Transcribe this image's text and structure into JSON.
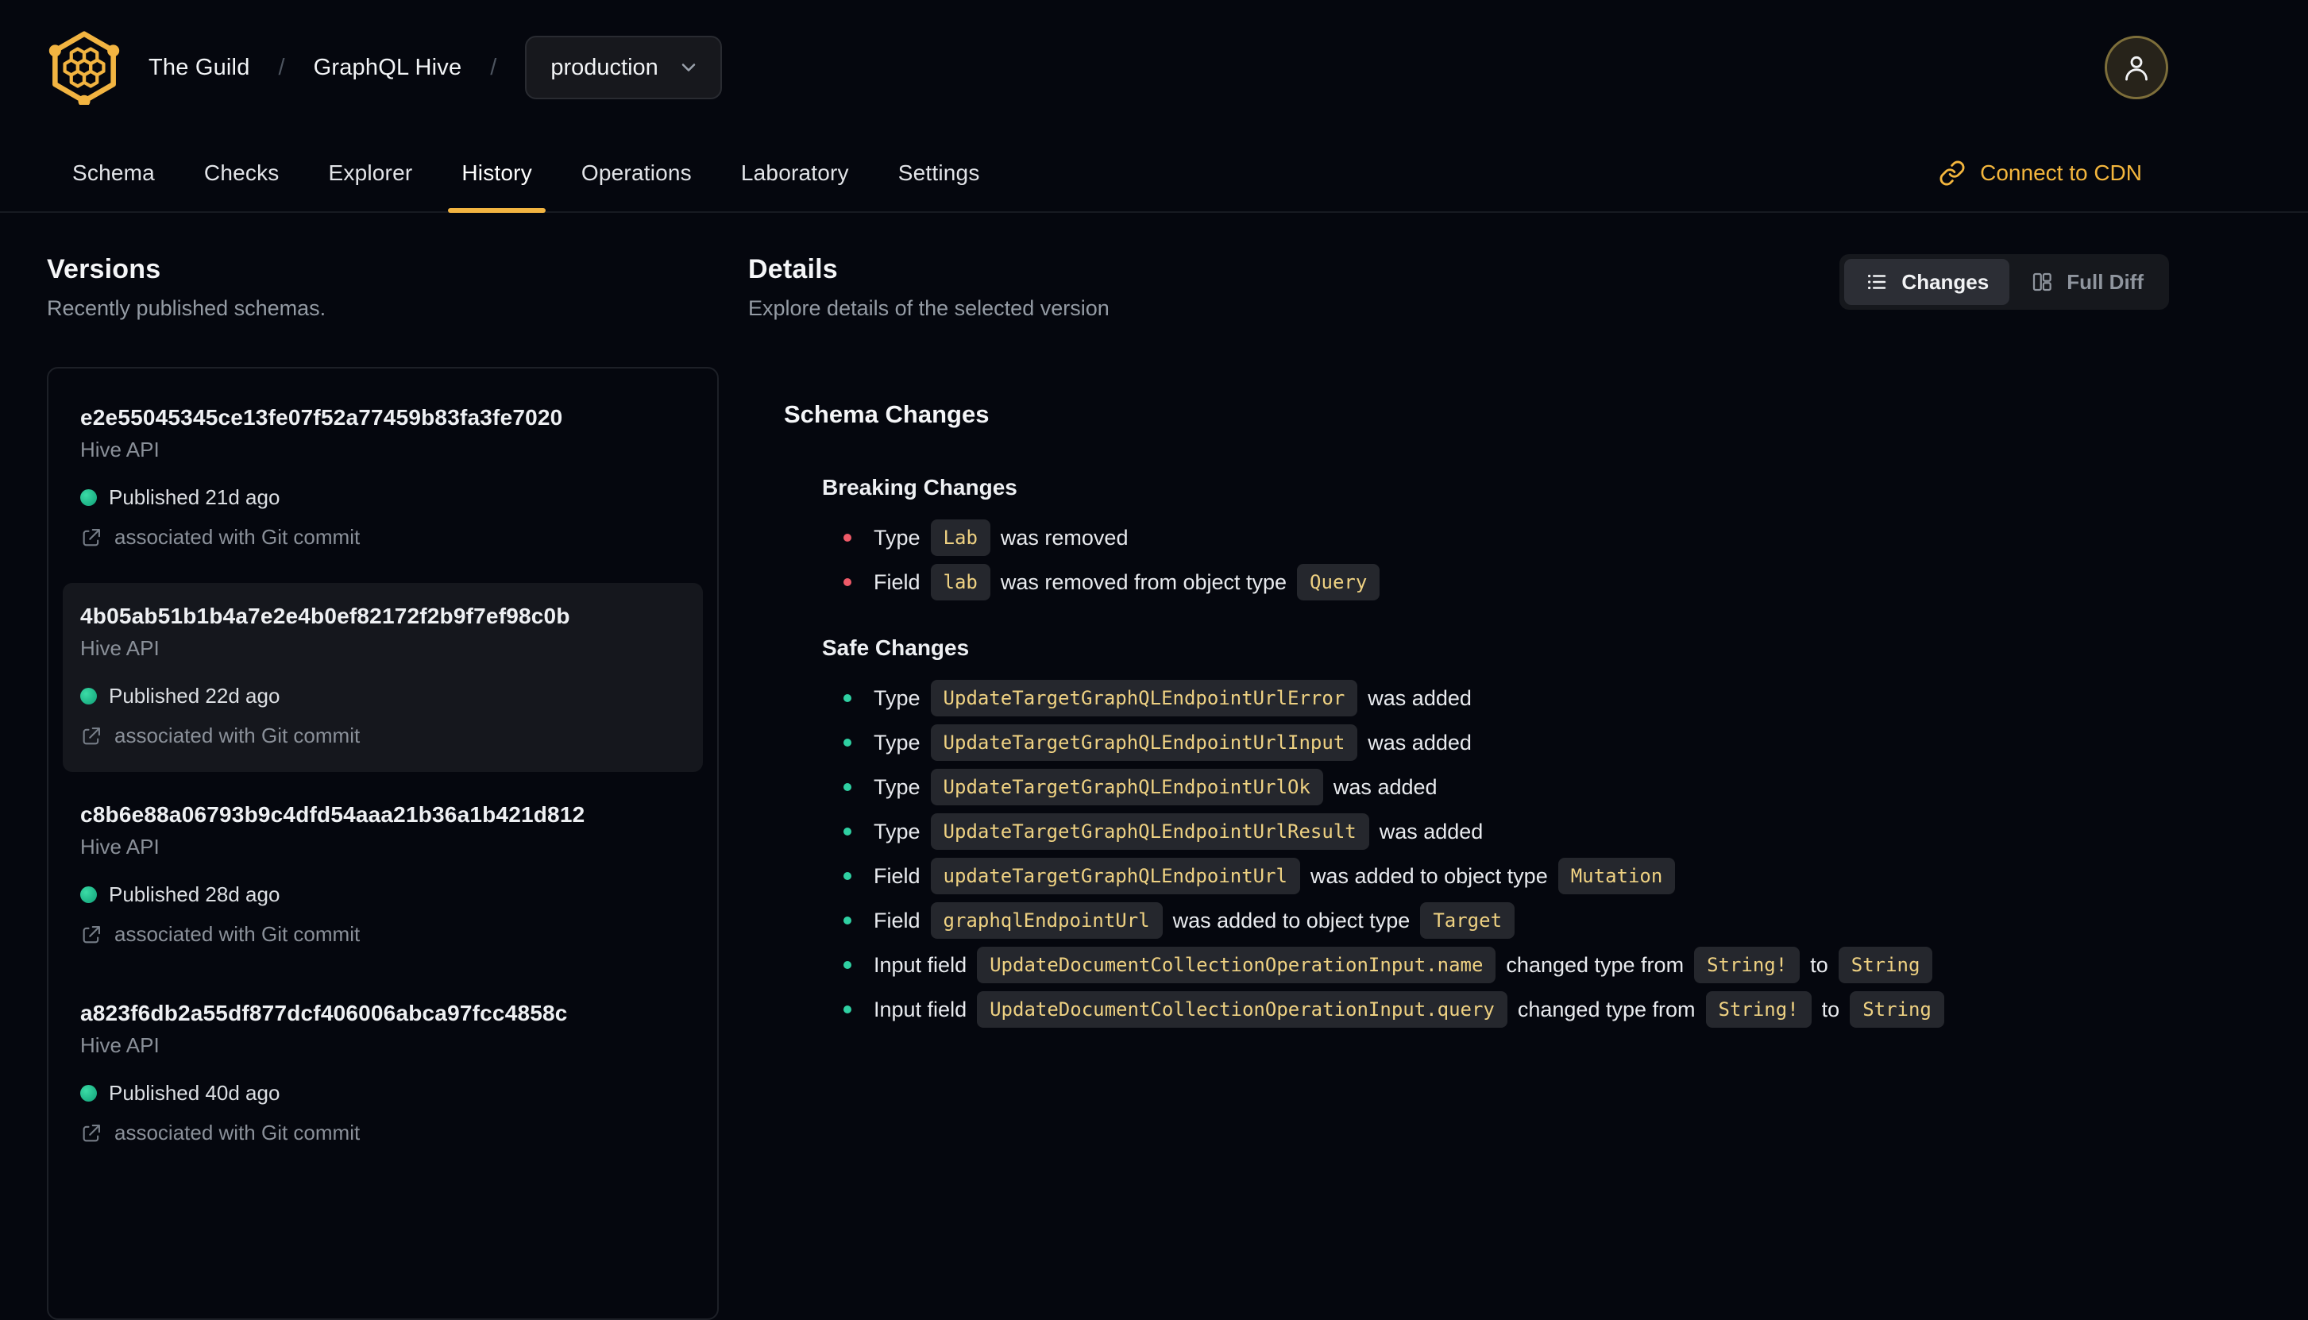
{
  "header": {
    "org": "The Guild",
    "separator": "/",
    "project": "GraphQL Hive",
    "target_selector": {
      "value": "production"
    },
    "tabs": [
      {
        "label": "Schema",
        "active": false
      },
      {
        "label": "Checks",
        "active": false
      },
      {
        "label": "Explorer",
        "active": false
      },
      {
        "label": "History",
        "active": true
      },
      {
        "label": "Operations",
        "active": false
      },
      {
        "label": "Laboratory",
        "active": false
      },
      {
        "label": "Settings",
        "active": false
      }
    ],
    "connect_cdn_label": "Connect to CDN"
  },
  "versions": {
    "title": "Versions",
    "subtitle": "Recently published schemas.",
    "items": [
      {
        "hash": "e2e55045345ce13fe07f52a77459b83fa3fe7020",
        "service": "Hive API",
        "status": "Published 21d ago",
        "git": "associated with Git commit",
        "selected": false
      },
      {
        "hash": "4b05ab51b1b4a7e2e4b0ef82172f2b9f7ef98c0b",
        "service": "Hive API",
        "status": "Published 22d ago",
        "git": "associated with Git commit",
        "selected": true
      },
      {
        "hash": "c8b6e88a06793b9c4dfd54aaa21b36a1b421d812",
        "service": "Hive API",
        "status": "Published 28d ago",
        "git": "associated with Git commit",
        "selected": false
      },
      {
        "hash": "a823f6db2a55df877dcf406006abca97fcc4858c",
        "service": "Hive API",
        "status": "Published 40d ago",
        "git": "associated with Git commit",
        "selected": false
      }
    ]
  },
  "details": {
    "title": "Details",
    "subtitle": "Explore details of the selected version",
    "toggle": {
      "changes_label": "Changes",
      "full_diff_label": "Full Diff",
      "active": "Changes"
    },
    "schema": {
      "title": "Schema Changes",
      "breaking_title": "Breaking Changes",
      "breaking_items": [
        {
          "segments": [
            {
              "t": "text",
              "v": "Type"
            },
            {
              "t": "code",
              "v": "Lab"
            },
            {
              "t": "text",
              "v": "was removed"
            }
          ]
        },
        {
          "segments": [
            {
              "t": "text",
              "v": "Field"
            },
            {
              "t": "code",
              "v": "lab"
            },
            {
              "t": "text",
              "v": "was removed from object type"
            },
            {
              "t": "code",
              "v": "Query"
            }
          ]
        }
      ],
      "safe_title": "Safe Changes",
      "safe_items": [
        {
          "segments": [
            {
              "t": "text",
              "v": "Type"
            },
            {
              "t": "code",
              "v": "UpdateTargetGraphQLEndpointUrlError"
            },
            {
              "t": "text",
              "v": "was added"
            }
          ]
        },
        {
          "segments": [
            {
              "t": "text",
              "v": "Type"
            },
            {
              "t": "code",
              "v": "UpdateTargetGraphQLEndpointUrlInput"
            },
            {
              "t": "text",
              "v": "was added"
            }
          ]
        },
        {
          "segments": [
            {
              "t": "text",
              "v": "Type"
            },
            {
              "t": "code",
              "v": "UpdateTargetGraphQLEndpointUrlOk"
            },
            {
              "t": "text",
              "v": "was added"
            }
          ]
        },
        {
          "segments": [
            {
              "t": "text",
              "v": "Type"
            },
            {
              "t": "code",
              "v": "UpdateTargetGraphQLEndpointUrlResult"
            },
            {
              "t": "text",
              "v": "was added"
            }
          ]
        },
        {
          "segments": [
            {
              "t": "text",
              "v": "Field"
            },
            {
              "t": "code",
              "v": "updateTargetGraphQLEndpointUrl"
            },
            {
              "t": "text",
              "v": "was added to object type"
            },
            {
              "t": "code",
              "v": "Mutation"
            }
          ]
        },
        {
          "segments": [
            {
              "t": "text",
              "v": "Field"
            },
            {
              "t": "code",
              "v": "graphqlEndpointUrl"
            },
            {
              "t": "text",
              "v": "was added to object type"
            },
            {
              "t": "code",
              "v": "Target"
            }
          ]
        },
        {
          "segments": [
            {
              "t": "text",
              "v": "Input field"
            },
            {
              "t": "code",
              "v": "UpdateDocumentCollectionOperationInput.name"
            },
            {
              "t": "text",
              "v": "changed type from"
            },
            {
              "t": "code",
              "v": "String!"
            },
            {
              "t": "text",
              "v": "to"
            },
            {
              "t": "code",
              "v": "String"
            }
          ]
        },
        {
          "segments": [
            {
              "t": "text",
              "v": "Input field"
            },
            {
              "t": "code",
              "v": "UpdateDocumentCollectionOperationInput.query"
            },
            {
              "t": "text",
              "v": "changed type from"
            },
            {
              "t": "code",
              "v": "String!"
            },
            {
              "t": "text",
              "v": "to"
            },
            {
              "t": "code",
              "v": "String"
            }
          ]
        }
      ]
    }
  },
  "colors": {
    "background": "#05070e",
    "accent_yellow": "#f2b441",
    "code_yellow": "#eed182",
    "published_green": "#10b981",
    "breaking_red": "#ee5a68",
    "safe_teal": "#2fd0a2"
  }
}
